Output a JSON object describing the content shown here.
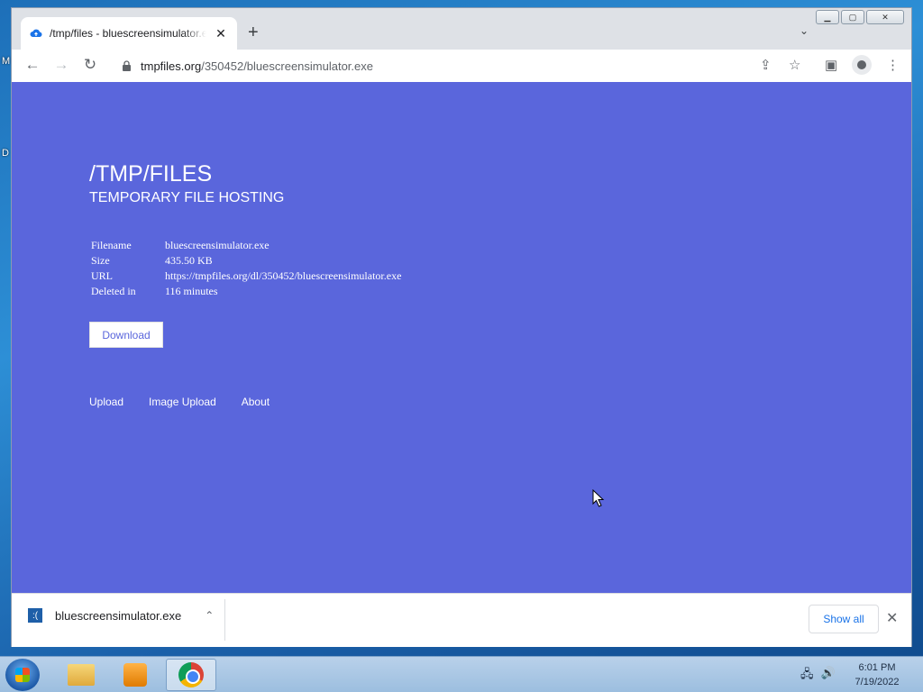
{
  "desktop": {
    "frag1": "M",
    "frag2": "D"
  },
  "browser": {
    "tab": {
      "title": "/tmp/files - bluescreensimulator.exe",
      "close": "✕"
    },
    "new_tab": "+",
    "tab_search": "⌄",
    "controls": {
      "minimize": "▁",
      "maximize": "▢",
      "close": "✕"
    },
    "nav": {
      "back": "←",
      "forward": "→",
      "reload": "↻"
    },
    "url": {
      "host": "tmpfiles.org",
      "path": "/350452/bluescreensimulator.exe"
    },
    "icons": {
      "share": "⇪",
      "star": "☆",
      "sidebar": "▣",
      "menu": "⋮"
    }
  },
  "page": {
    "title": "/TMP/FILES",
    "subtitle": "TEMPORARY FILE HOSTING",
    "info": [
      {
        "key": "Filename",
        "value": "bluescreensimulator.exe"
      },
      {
        "key": "Size",
        "value": "435.50 KB"
      },
      {
        "key": "URL",
        "value": "https://tmpfiles.org/dl/350452/bluescreensimulator.exe"
      },
      {
        "key": "Deleted in",
        "value": "116 minutes"
      }
    ],
    "download_label": "Download",
    "links": {
      "upload": "Upload",
      "image_upload": "Image Upload",
      "about": "About"
    },
    "background": "#5a66dc"
  },
  "download_shelf": {
    "file_name": "bluescreensimulator.exe",
    "file_icon": ":(",
    "chevron": "⌃",
    "show_all": "Show all",
    "close": "✕"
  },
  "taskbar": {
    "time": "6:01 PM",
    "date": "7/19/2022",
    "tray": {
      "network": "🖧",
      "volume": "🔊"
    }
  }
}
